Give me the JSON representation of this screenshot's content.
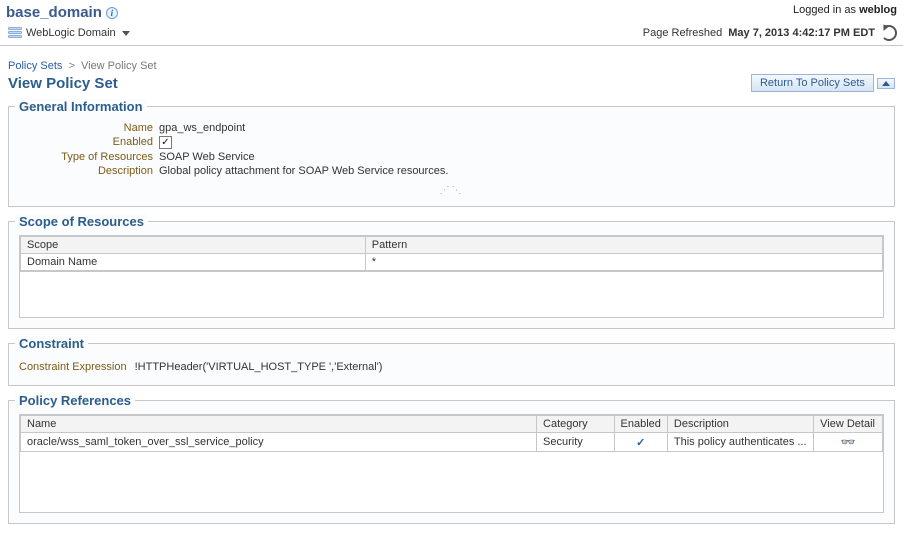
{
  "header": {
    "domain_title": "base_domain",
    "logged_in_prefix": "Logged in as ",
    "logged_in_user": "weblog"
  },
  "subheader": {
    "menu_label": "WebLogic Domain",
    "refresh_prefix": "Page Refreshed ",
    "refresh_time": "May 7, 2013 4:42:17 PM EDT"
  },
  "breadcrumbs": {
    "root": "Policy Sets",
    "current": "View Policy Set"
  },
  "page_title": "View Policy Set",
  "return_button": "Return To Policy Sets",
  "general": {
    "title": "General Information",
    "labels": {
      "name": "Name",
      "enabled": "Enabled",
      "type": "Type of Resources",
      "desc": "Description"
    },
    "values": {
      "name": "gpa_ws_endpoint",
      "enabled": true,
      "type": "SOAP Web Service",
      "desc": "Global policy attachment for SOAP Web Service resources."
    }
  },
  "scope": {
    "title": "Scope of Resources",
    "columns": {
      "scope": "Scope",
      "pattern": "Pattern"
    },
    "rows": [
      {
        "scope": "Domain Name",
        "pattern": "*"
      }
    ]
  },
  "constraint": {
    "title": "Constraint",
    "label": "Constraint Expression",
    "value": "!HTTPHeader('VIRTUAL_HOST_TYPE ','External')"
  },
  "pref": {
    "title": "Policy References",
    "columns": {
      "name": "Name",
      "category": "Category",
      "enabled": "Enabled",
      "desc": "Description",
      "detail": "View Detail"
    },
    "rows": [
      {
        "name": "oracle/wss_saml_token_over_ssl_service_policy",
        "category": "Security",
        "enabled": "✓",
        "desc": "This policy authenticates ..."
      }
    ]
  }
}
